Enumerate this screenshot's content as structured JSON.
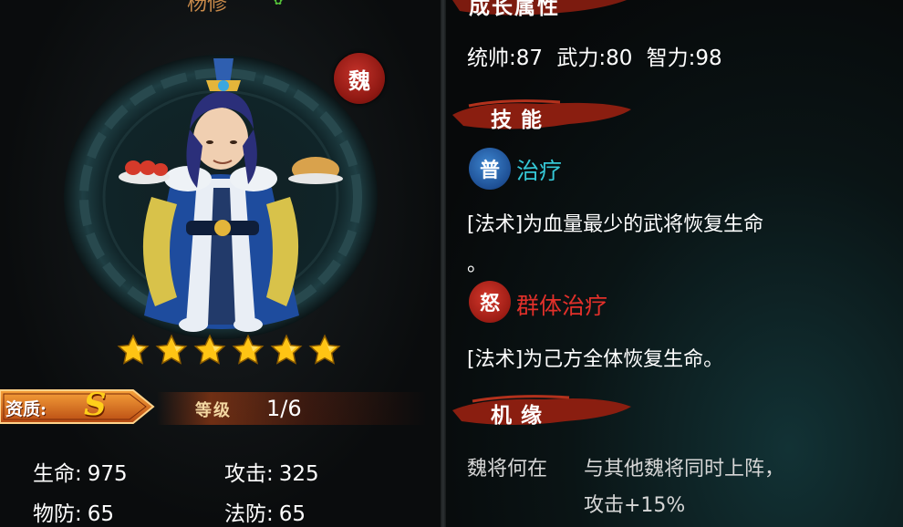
{
  "hero": {
    "name_partial": "杨修",
    "faction": "魏",
    "stars": 6
  },
  "grade": {
    "label": "资质:",
    "value": "S"
  },
  "level": {
    "label": "等级",
    "value": "1/6"
  },
  "stats": [
    {
      "key": "生命:",
      "value": "975"
    },
    {
      "key": "攻击:",
      "value": "325"
    },
    {
      "key": "物防:",
      "value": "65"
    },
    {
      "key": "法防:",
      "value": "65"
    }
  ],
  "growth": {
    "title": "成长属性",
    "line": "统帅:87 武力:80 智力:98"
  },
  "skills_section": {
    "title": "技能"
  },
  "skills": [
    {
      "badge": "普",
      "badge_color": "#2a6db5",
      "name": "治疗",
      "name_color": "#35c8d6",
      "desc_line1": "[法术]为血量最少的武将恢复生命",
      "desc_line2": "。"
    },
    {
      "badge": "怒",
      "badge_color": "#b3261e",
      "name": "群体治疗",
      "name_color": "#e2302a",
      "desc_line1": "[法术]为己方全体恢复生命。"
    }
  ],
  "fate_section": {
    "title": "机缘"
  },
  "fate": {
    "label": "魏将何在",
    "line1": "与其他魏将同时上阵，",
    "line2": "攻击+15%"
  },
  "colors": {
    "gold": "#ffcf1a",
    "brush_red": "#8a1e10",
    "teal": "#35c8d6"
  }
}
